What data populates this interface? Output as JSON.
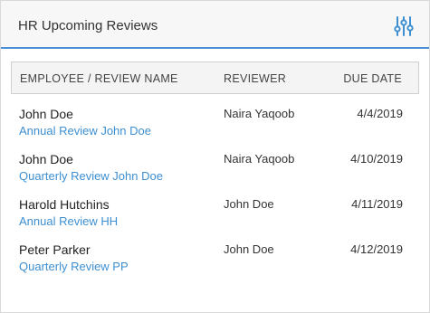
{
  "widget": {
    "title": "HR Upcoming Reviews",
    "settings_icon": "sliders-icon",
    "accent_color": "#4a90d9",
    "link_color": "#3d8fd1"
  },
  "table": {
    "headers": {
      "employee": "EMPLOYEE / REVIEW NAME",
      "reviewer": "REVIEWER",
      "due_date": "DUE DATE"
    },
    "rows": [
      {
        "employee": "John Doe",
        "review": "Annual Review John Doe",
        "reviewer": "Naira Yaqoob",
        "due_date": "4/4/2019"
      },
      {
        "employee": "John Doe",
        "review": "Quarterly Review John Doe",
        "reviewer": "Naira Yaqoob",
        "due_date": "4/10/2019"
      },
      {
        "employee": "Harold Hutchins",
        "review": "Annual Review HH",
        "reviewer": "John Doe",
        "due_date": "4/11/2019"
      },
      {
        "employee": "Peter Parker",
        "review": "Quarterly Review PP",
        "reviewer": "John Doe",
        "due_date": "4/12/2019"
      }
    ]
  }
}
